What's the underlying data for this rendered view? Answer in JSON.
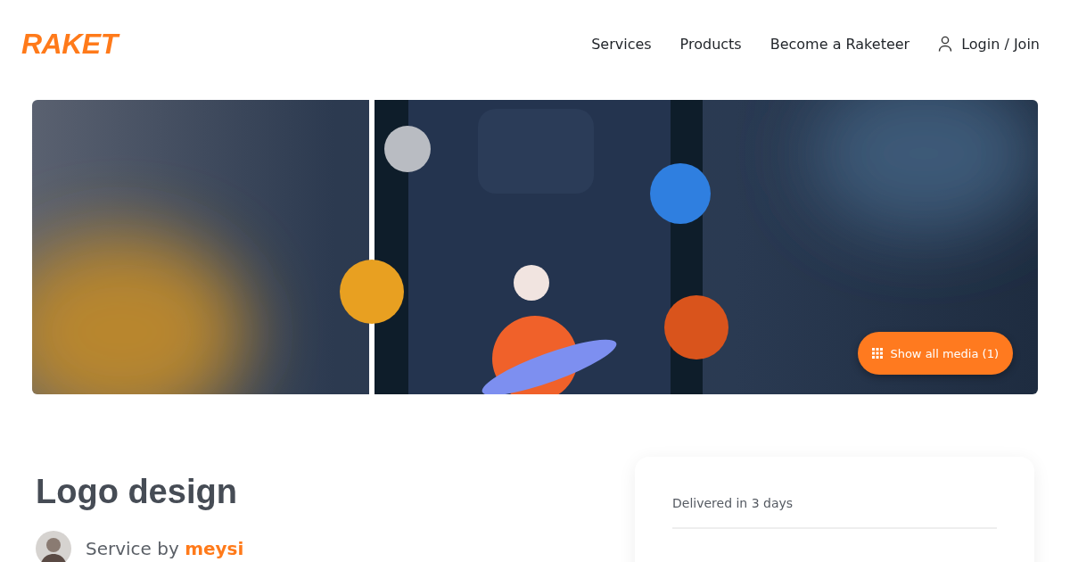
{
  "header": {
    "logo": "RAKET",
    "nav": [
      {
        "label": "Services",
        "kind": "link"
      },
      {
        "label": "Products",
        "kind": "link"
      },
      {
        "label": "Become a Raketeer",
        "kind": "link"
      },
      {
        "label": "Login / Join",
        "kind": "account"
      }
    ]
  },
  "gallery": {
    "show_all_button": "Show all media (1)"
  },
  "service": {
    "title": "Logo design",
    "by_label": "Service by",
    "seller": "meysi"
  },
  "order_card": {
    "delivery": "Delivered in 3 days"
  }
}
